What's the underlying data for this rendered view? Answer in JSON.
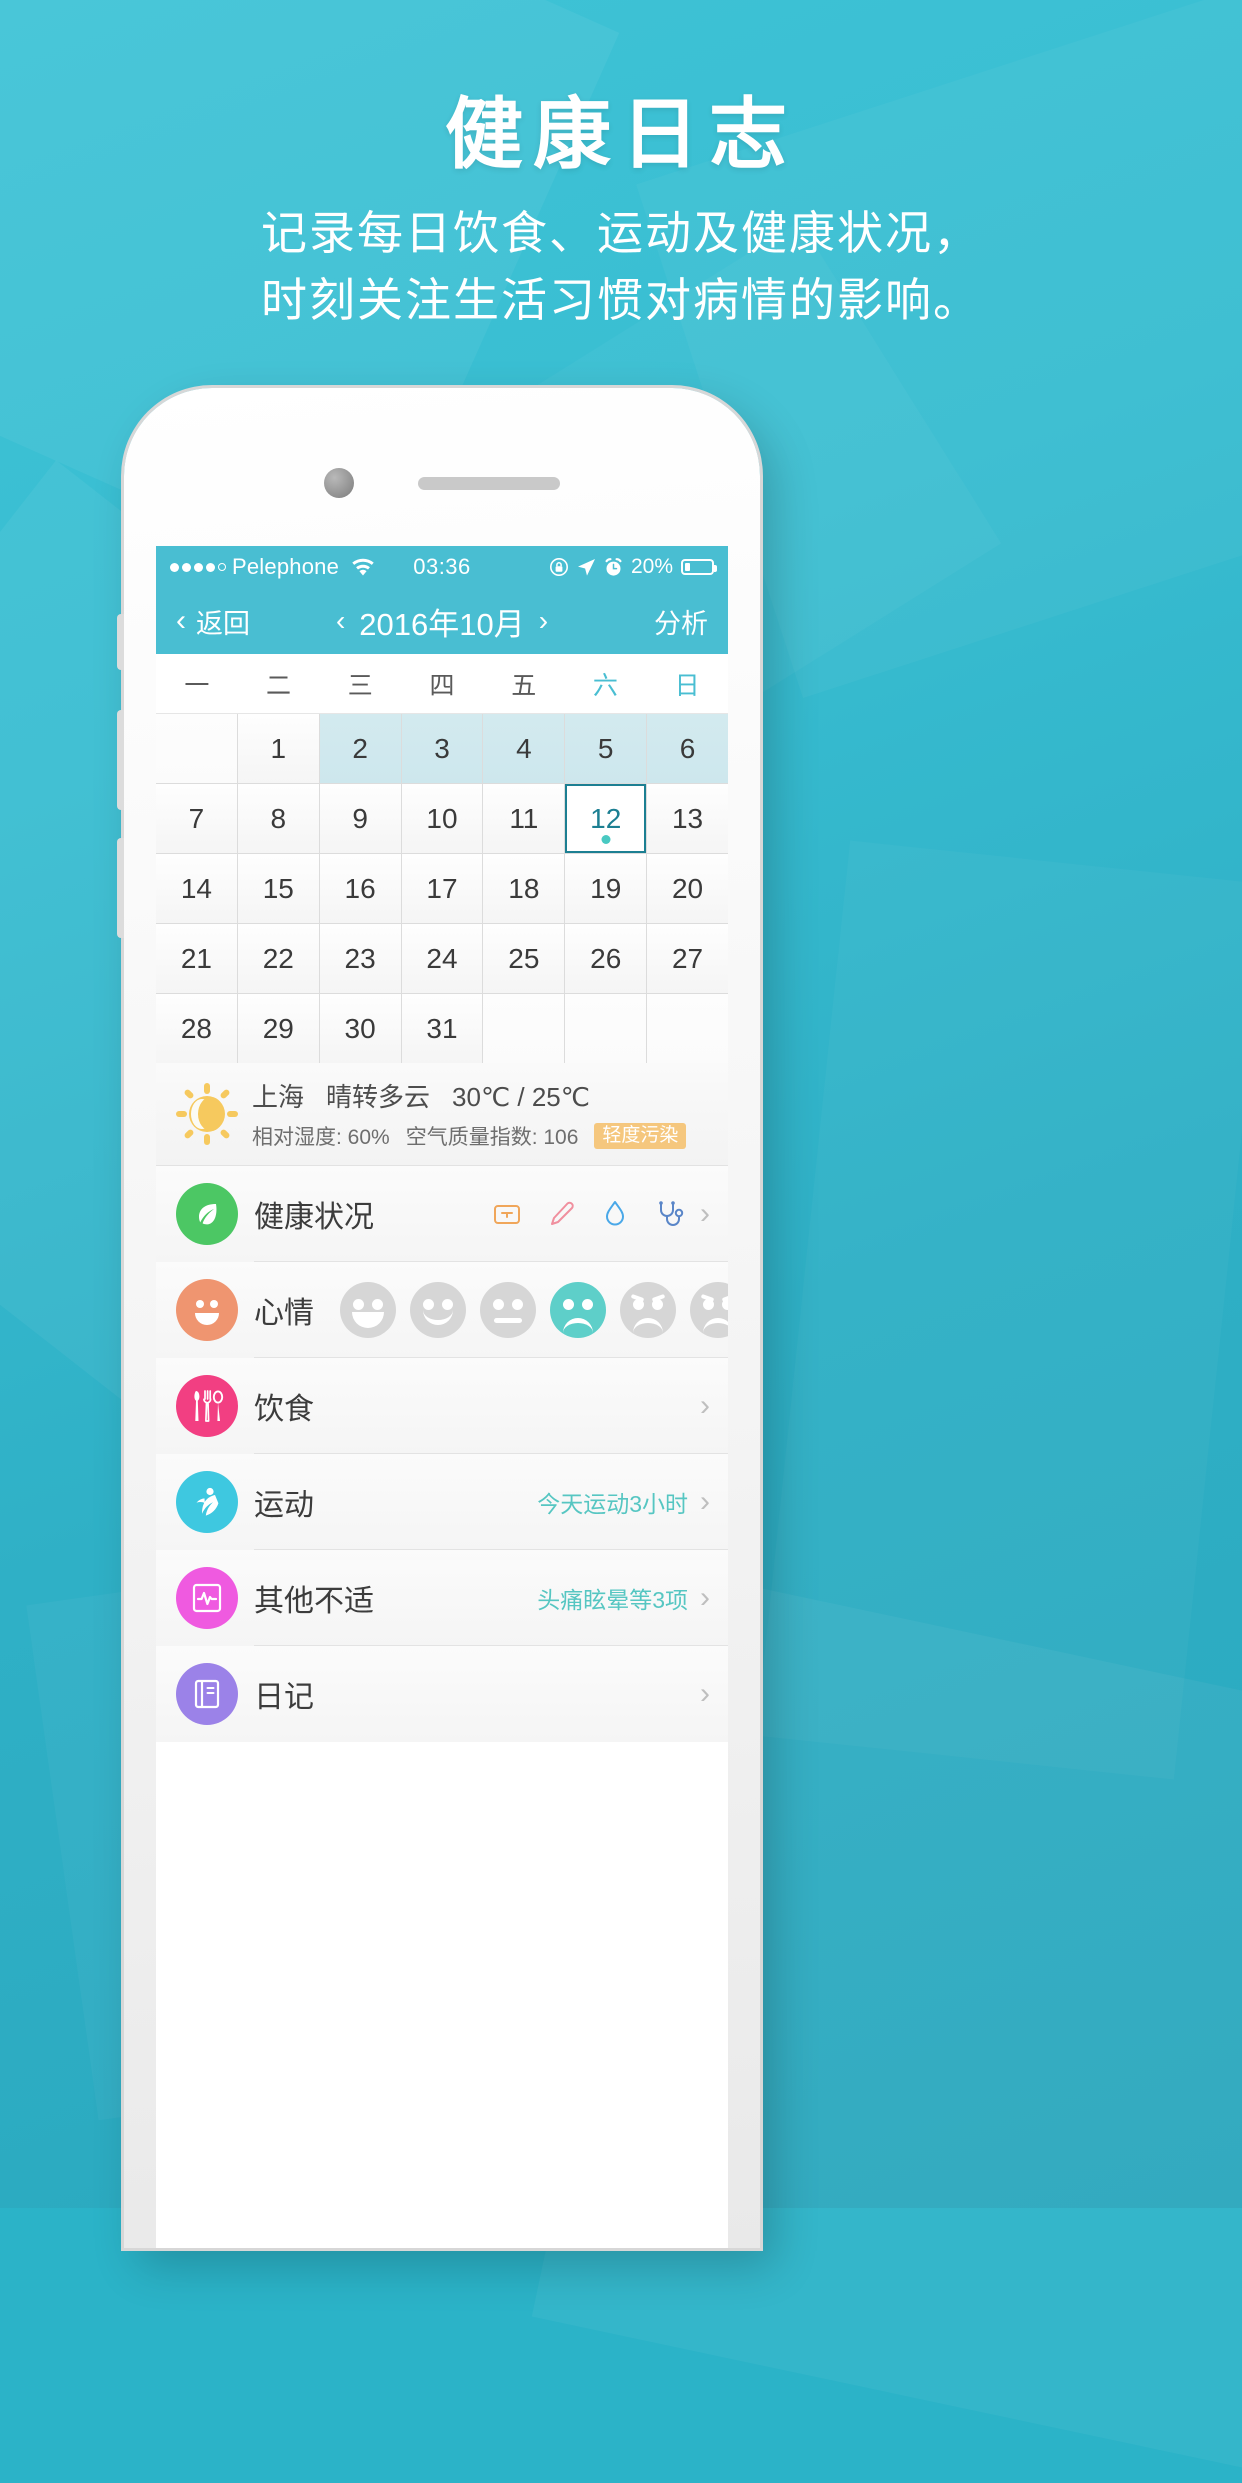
{
  "promo": {
    "title": "健康日志",
    "subtitle_line1": "记录每日饮食、运动及健康状况，",
    "subtitle_line2": "时刻关注生活习惯对病情的影响。"
  },
  "statusbar": {
    "carrier": "Pelephone",
    "wifi_icon": "wifi-icon",
    "time": "03:36",
    "rotation_lock_icon": "rotation-lock-icon",
    "location_icon": "location-arrow-icon",
    "alarm_icon": "alarm-clock-icon",
    "battery_percent": "20%",
    "battery_level": 20
  },
  "navbar": {
    "back_label": "返回",
    "back_chevron": "‹",
    "prev_arrow": "‹",
    "month_title": "2016年10月",
    "next_arrow": "›",
    "action_label": "分析"
  },
  "calendar": {
    "weekdays": [
      {
        "label": "一",
        "weekend": false
      },
      {
        "label": "二",
        "weekend": false
      },
      {
        "label": "三",
        "weekend": false
      },
      {
        "label": "四",
        "weekend": false
      },
      {
        "label": "五",
        "weekend": false
      },
      {
        "label": "六",
        "weekend": true
      },
      {
        "label": "日",
        "weekend": true
      }
    ],
    "cells": [
      {
        "label": "",
        "state": "blank"
      },
      {
        "label": "1",
        "state": "normal"
      },
      {
        "label": "2",
        "state": "highlight"
      },
      {
        "label": "3",
        "state": "highlight"
      },
      {
        "label": "4",
        "state": "highlight"
      },
      {
        "label": "5",
        "state": "highlight"
      },
      {
        "label": "6",
        "state": "highlight"
      },
      {
        "label": "7",
        "state": "normal"
      },
      {
        "label": "8",
        "state": "normal"
      },
      {
        "label": "9",
        "state": "normal"
      },
      {
        "label": "10",
        "state": "normal"
      },
      {
        "label": "11",
        "state": "normal"
      },
      {
        "label": "12",
        "state": "selected",
        "dot": true
      },
      {
        "label": "13",
        "state": "normal"
      },
      {
        "label": "14",
        "state": "normal"
      },
      {
        "label": "15",
        "state": "normal"
      },
      {
        "label": "16",
        "state": "normal"
      },
      {
        "label": "17",
        "state": "normal"
      },
      {
        "label": "18",
        "state": "normal"
      },
      {
        "label": "19",
        "state": "normal"
      },
      {
        "label": "20",
        "state": "normal"
      },
      {
        "label": "21",
        "state": "normal"
      },
      {
        "label": "22",
        "state": "normal"
      },
      {
        "label": "23",
        "state": "normal"
      },
      {
        "label": "24",
        "state": "normal"
      },
      {
        "label": "25",
        "state": "normal"
      },
      {
        "label": "26",
        "state": "normal"
      },
      {
        "label": "27",
        "state": "normal"
      },
      {
        "label": "28",
        "state": "normal"
      },
      {
        "label": "29",
        "state": "normal"
      },
      {
        "label": "30",
        "state": "normal"
      },
      {
        "label": "31",
        "state": "normal"
      },
      {
        "label": "",
        "state": "blank"
      },
      {
        "label": "",
        "state": "blank"
      },
      {
        "label": "",
        "state": "blank"
      }
    ]
  },
  "weather": {
    "icon": "sun-behind-moon-icon",
    "city": "上海",
    "condition": "晴转多云",
    "temperature": "30℃ / 25℃",
    "humidity": "相对湿度: 60%",
    "aqi": "空气质量指数: 106",
    "aqi_badge": "轻度污染",
    "aqi_badge_color": "#f5c77e"
  },
  "rows": [
    {
      "id": "health",
      "icon": "leaf-icon",
      "icon_color": "#4cc764",
      "label": "健康状况",
      "mini_icons": [
        "scale-icon",
        "thermometer-icon",
        "blood-drop-icon",
        "stethoscope-icon"
      ],
      "value": "",
      "chevron": "›"
    },
    {
      "id": "mood",
      "icon": "smiley-icon",
      "icon_color": "#ef9570",
      "label": "心情",
      "moods": [
        {
          "name": "mood-laugh",
          "selected": false
        },
        {
          "name": "mood-smile",
          "selected": false
        },
        {
          "name": "mood-neutral",
          "selected": false
        },
        {
          "name": "mood-sad",
          "selected": true
        },
        {
          "name": "mood-upset",
          "selected": false
        },
        {
          "name": "mood-cry",
          "selected": false
        }
      ],
      "value": "",
      "chevron": ""
    },
    {
      "id": "diet",
      "icon": "cutlery-icon",
      "icon_color": "#f23f82",
      "label": "饮食",
      "value": "",
      "chevron": "›"
    },
    {
      "id": "exercise",
      "icon": "runner-icon",
      "icon_color": "#3ec8e0",
      "label": "运动",
      "value": "今天运动3小时",
      "chevron": "›"
    },
    {
      "id": "discomfort",
      "icon": "monitor-pulse-icon",
      "icon_color": "#ef5ae0",
      "label": "其他不适",
      "value": "头痛眩晕等3项",
      "chevron": "›"
    },
    {
      "id": "diary",
      "icon": "book-icon",
      "icon_color": "#9b82e8",
      "label": "日记",
      "value": "",
      "chevron": "›"
    }
  ],
  "colors": {
    "brand": "#49bed2",
    "page_bg": "#2fb0c6",
    "selected_day": "#1c7f92",
    "highlight_cell": "#cde7ed",
    "accent_value": "#56c6c2"
  }
}
